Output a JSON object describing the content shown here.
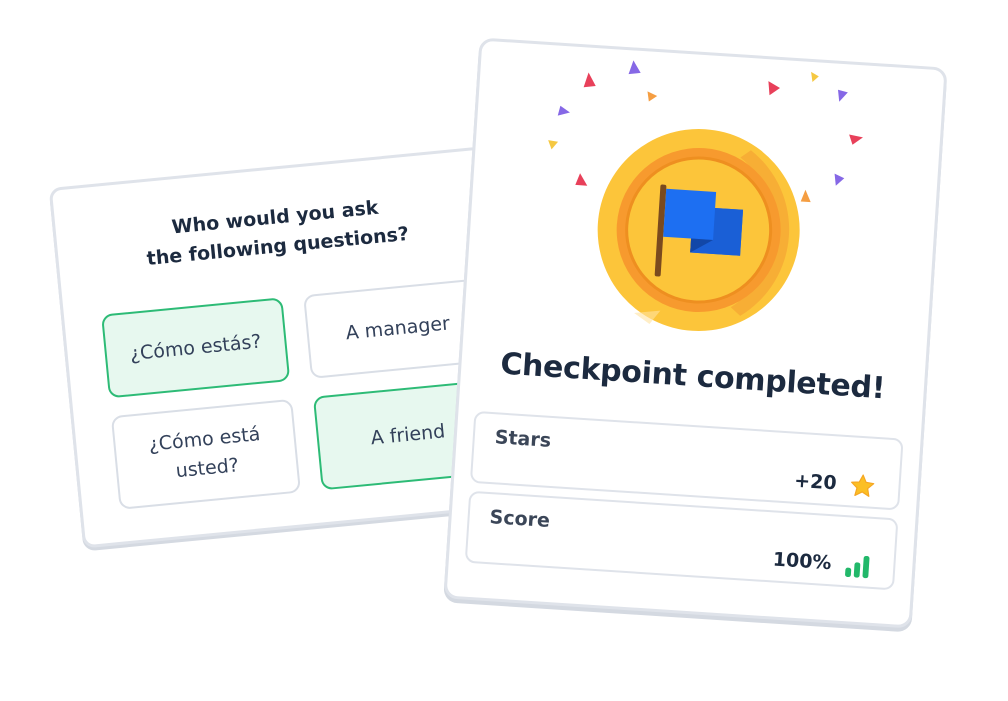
{
  "quiz": {
    "question_line1": "Who would you ask",
    "question_line2": "the following questions?",
    "options": [
      {
        "lines": [
          "¿Cómo estás?"
        ],
        "selected": true
      },
      {
        "lines": [
          "A manager"
        ],
        "selected": false
      },
      {
        "lines": [
          "¿Cómo está",
          "usted?"
        ],
        "selected": false
      },
      {
        "lines": [
          "A friend"
        ],
        "selected": true
      }
    ]
  },
  "checkpoint": {
    "title": "Checkpoint completed!",
    "medal_icon": "flag-medal-icon",
    "stats": [
      {
        "label": "Stars",
        "value": "+20",
        "icon": "star-icon"
      },
      {
        "label": "Score",
        "value": "100%",
        "icon": "signal-bars-icon"
      }
    ]
  },
  "colors": {
    "selected_fill": "#e7f8ef",
    "selected_border": "#2dbb76",
    "medal_gold": "#fcc53a",
    "medal_orange": "#f79a2e",
    "flag_blue": "#1d6ff2",
    "star_yellow": "#fbbf24",
    "bars_green": "#22b86a"
  }
}
